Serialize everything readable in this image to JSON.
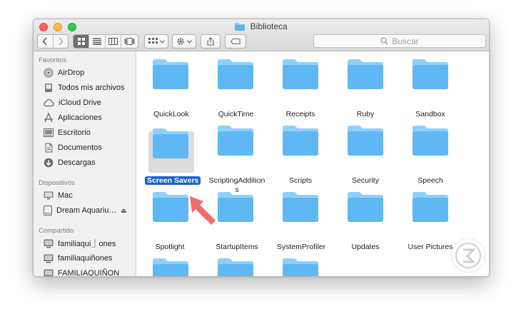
{
  "window": {
    "title": "Biblioteca"
  },
  "toolbar": {
    "search_placeholder": "Buscar",
    "icons": [
      "chevron-left-icon",
      "chevron-right-icon",
      "icon-view-icon",
      "list-view-icon",
      "column-view-icon",
      "coverflow-view-icon",
      "arrange-icon",
      "gear-icon",
      "share-icon",
      "tag-icon",
      "search-icon"
    ]
  },
  "sidebar": {
    "favorites_label": "Favoritos",
    "favorites": [
      {
        "label": "AirDrop",
        "icon": "airdrop-icon"
      },
      {
        "label": "Todos mis archivos",
        "icon": "all-files-icon"
      },
      {
        "label": "iCloud Drive",
        "icon": "cloud-icon"
      },
      {
        "label": "Aplicaciones",
        "icon": "applications-icon"
      },
      {
        "label": "Escritorio",
        "icon": "desktop-icon"
      },
      {
        "label": "Documentos",
        "icon": "documents-icon"
      },
      {
        "label": "Descargas",
        "icon": "downloads-icon"
      }
    ],
    "devices_label": "Dispositivos",
    "devices": [
      {
        "label": "Mac",
        "icon": "computer-icon"
      },
      {
        "label": "Dream Aquariu…",
        "icon": "disk-icon"
      }
    ],
    "shared_label": "Compartido",
    "shared": [
      {
        "label": "familiaqui⏌ones",
        "icon": "monitor-icon"
      },
      {
        "label": "familiaquiñones",
        "icon": "monitor-icon"
      },
      {
        "label": "FAMILIAQUIÑON",
        "icon": "monitor-icon"
      }
    ]
  },
  "folders": {
    "row1": [
      "QuickLook",
      "QuickTime",
      "Receipts",
      "Ruby",
      "Sandbox"
    ],
    "row2": [
      "Screen Savers",
      "ScriptingAdditions",
      "Scripts",
      "Security",
      "Speech"
    ],
    "row2_scripting_line1": "ScriptingAddition",
    "row2_scripting_line2": "s",
    "row3": [
      "Spotlight",
      "StartupItems",
      "SystemProfiler",
      "Updates",
      "User Pictures"
    ]
  },
  "selected_folder": "Screen Savers",
  "colors": {
    "folder": "#5fb8f4",
    "folder_tab": "#8fd0fb",
    "selection": "#1761d8",
    "arrow": "#f26b6b"
  }
}
